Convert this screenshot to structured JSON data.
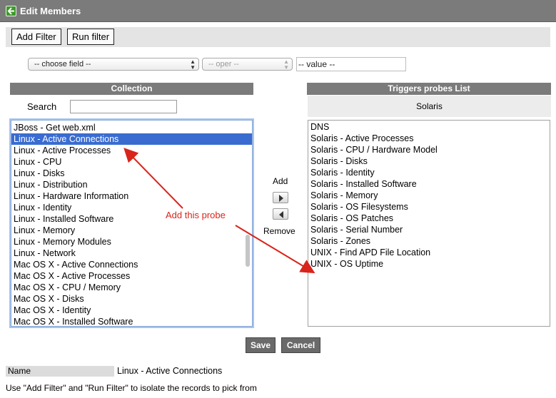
{
  "window": {
    "title": "Edit Members"
  },
  "filter": {
    "add_filter_label": "Add Filter",
    "run_filter_label": "Run filter",
    "field_select": "-- choose field --",
    "oper_select": "-- oper --",
    "value_input": "-- value --"
  },
  "collection": {
    "header": "Collection",
    "search_label": "Search",
    "search_value": "",
    "items": [
      "JBoss - Get web.xml",
      "Linux - Active Connections",
      "Linux - Active Processes",
      "Linux - CPU",
      "Linux - Disks",
      "Linux - Distribution",
      "Linux - Hardware Information",
      "Linux - Identity",
      "Linux - Installed Software",
      "Linux - Memory",
      "Linux - Memory Modules",
      "Linux - Network",
      "Mac OS X - Active Connections",
      "Mac OS X - Active Processes",
      "Mac OS X - CPU / Memory",
      "Mac OS X - Disks",
      "Mac OS X - Identity",
      "Mac OS X - Installed Software"
    ],
    "selected_item": "Linux - Active Connections"
  },
  "transfer": {
    "add_label": "Add",
    "remove_label": "Remove"
  },
  "triggers": {
    "header": "Triggers probes List",
    "group_label": "Solaris",
    "items": [
      "DNS",
      "Solaris - Active Processes",
      "Solaris - CPU / Hardware Model",
      "Solaris - Disks",
      "Solaris - Identity",
      "Solaris - Installed Software",
      "Solaris - Memory",
      "Solaris - OS Filesystems",
      "Solaris - OS Patches",
      "Solaris - Serial Number",
      "Solaris - Zones",
      "UNIX - Find APD File Location",
      "UNIX - OS Uptime"
    ]
  },
  "actions": {
    "save_label": "Save",
    "cancel_label": "Cancel"
  },
  "details": {
    "name_label": "Name",
    "name_value": "Linux - Active Connections"
  },
  "hint": "Use \"Add Filter\" and \"Run Filter\" to isolate the records to pick from",
  "annotation": {
    "text": "Add this probe",
    "color": "#d8241b"
  },
  "colors": {
    "header_gray": "#7b7b7b",
    "selection_blue": "#3a6cd0",
    "back_icon_green": "#3e9a2b"
  }
}
